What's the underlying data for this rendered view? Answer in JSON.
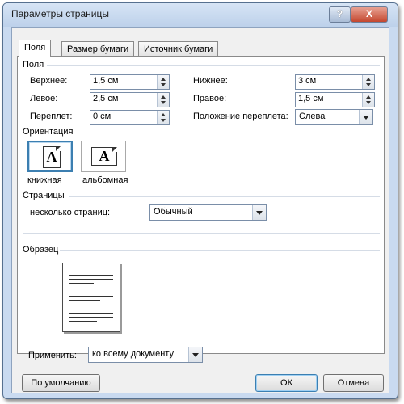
{
  "window": {
    "title": "Параметры страницы",
    "help_glyph": "?",
    "close_glyph": "X"
  },
  "tabs": [
    {
      "label": "Поля"
    },
    {
      "label": "Размер бумаги"
    },
    {
      "label": "Источник бумаги"
    }
  ],
  "margins": {
    "section_label": "Поля",
    "top": {
      "label": "Верхнее:",
      "value": "1,5 см"
    },
    "bottom": {
      "label": "Нижнее:",
      "value": "3 см"
    },
    "left": {
      "label": "Левое:",
      "value": "2,5 см"
    },
    "right": {
      "label": "Правое:",
      "value": "1,5 см"
    },
    "gutter": {
      "label": "Переплет:",
      "value": "0 см"
    },
    "gutter_pos": {
      "label": "Положение переплета:",
      "value": "Слева"
    }
  },
  "orientation": {
    "section_label": "Ориентация",
    "portrait": {
      "label": "книжная",
      "glyph": "A",
      "selected": true
    },
    "landscape": {
      "label": "альбомная",
      "glyph": "A",
      "selected": false
    }
  },
  "pages": {
    "section_label": "Страницы",
    "multiple_label": "несколько страниц:",
    "multiple_value": "Обычный"
  },
  "preview": {
    "section_label": "Образец"
  },
  "apply": {
    "label": "Применить:",
    "value": "ко всему документу"
  },
  "buttons": {
    "default": "По умолчанию",
    "ok": "ОК",
    "cancel": "Отмена"
  }
}
